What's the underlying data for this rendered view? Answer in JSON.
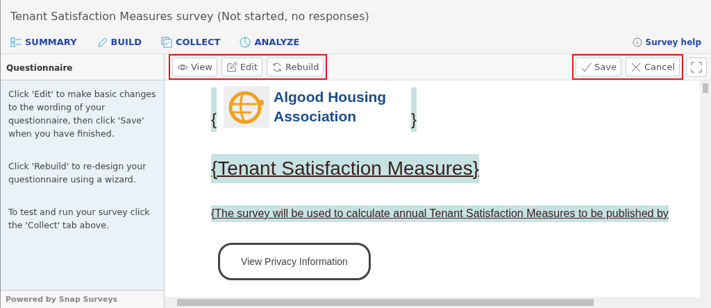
{
  "window": {
    "title": "Tenant Satisfaction Measures survey (Not started, no responses)"
  },
  "tabs": [
    {
      "label": "SUMMARY",
      "kind": "summary"
    },
    {
      "label": "BUILD",
      "kind": "build"
    },
    {
      "label": "COLLECT",
      "kind": "collect"
    },
    {
      "label": "ANALYZE",
      "kind": "analyze"
    }
  ],
  "help_link": "Survey help",
  "sidebar": {
    "title": "Questionnaire",
    "paragraphs": [
      "Click 'Edit' to make basic changes to the wording of your questionnaire, then click 'Save' when you have finished.",
      "Click 'Rebuild' to re-design your questionnaire using a wizard.",
      "To test and run your survey click the 'Collect' tab above."
    ],
    "footer": "Powered by Snap Surveys"
  },
  "toolbar": {
    "left": [
      {
        "label": "View",
        "kind": "eye"
      },
      {
        "label": "Edit",
        "kind": "edit"
      },
      {
        "label": "Rebuild",
        "kind": "refresh"
      }
    ],
    "right": [
      {
        "label": "Save",
        "kind": "check"
      },
      {
        "label": "Cancel",
        "kind": "cross"
      }
    ]
  },
  "document": {
    "open_brace": "{",
    "close_brace": "}",
    "logo_line_1": "Algood Housing",
    "logo_line_2": "Association",
    "heading": "{Tenant Satisfaction Measures}",
    "intro": "{The survey will be used to calculate annual Tenant Satisfaction Measures to be published by",
    "privacy_button": "View Privacy Information"
  }
}
